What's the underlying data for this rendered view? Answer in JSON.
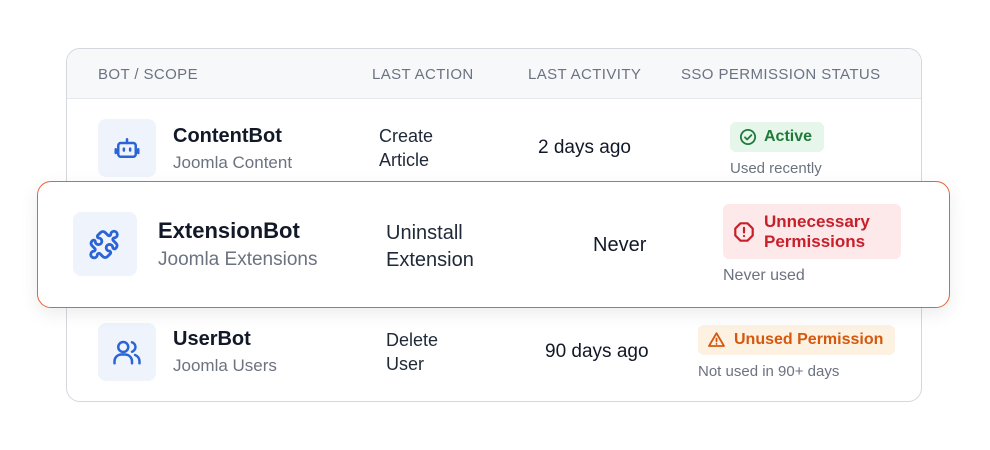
{
  "headers": {
    "bot_scope": "BOT / SCOPE",
    "last_action": "LAST ACTION",
    "last_activity": "LAST ACTIVITY",
    "sso_status": "SSO PERMISSION STATUS"
  },
  "rows": [
    {
      "icon": "robot-icon",
      "name": "ContentBot",
      "scope": "Joomla Content",
      "action_line1": "Create",
      "action_line2": "Article",
      "activity": "2 days ago",
      "badge": "Active",
      "badge_icon": "check-circle-icon",
      "note": "Used recently",
      "badge_bg": "#e6f6ea",
      "badge_color": "#1f7a3a"
    },
    {
      "icon": "puzzle-icon",
      "name": "ExtensionBot",
      "scope": "Joomla Extensions",
      "action_line1": "Uninstall",
      "action_line2": "Extension",
      "activity": "Never",
      "badge_line1": "Unnecessary",
      "badge_line2": "Permissions",
      "badge_icon": "alert-octagon-icon",
      "note": "Never used",
      "badge_bg": "#fde8ea",
      "badge_color": "#c8202b",
      "highlight_border": "#e2653a"
    },
    {
      "icon": "users-icon",
      "name": "UserBot",
      "scope": "Joomla Users",
      "action_line1": "Delete",
      "action_line2": "User",
      "activity": "90 days ago",
      "badge": "Unused Permission",
      "badge_icon": "warning-triangle-icon",
      "note": "Not used in 90+ days",
      "badge_bg": "#fdf1e2",
      "badge_color": "#d4590f"
    }
  ],
  "colors": {
    "icon_blue": "#2b64d6",
    "icon_bg": "#eef3fc"
  }
}
